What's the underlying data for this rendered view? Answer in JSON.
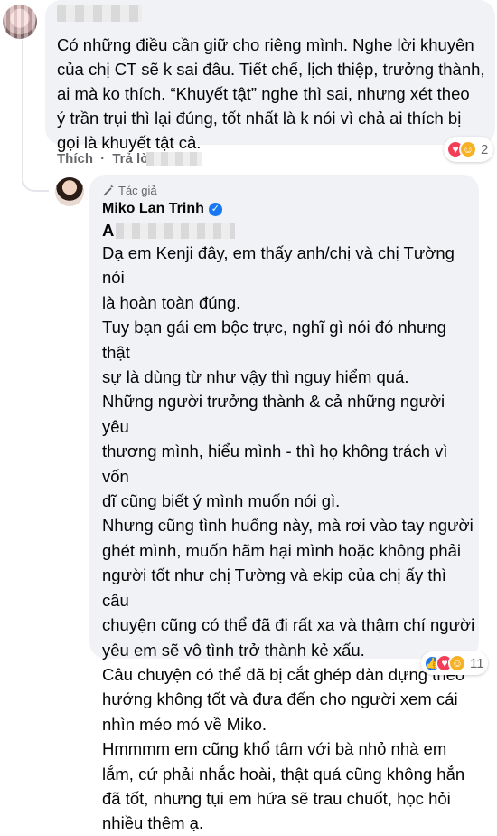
{
  "comment1": {
    "text": "Có những điều cần giữ cho riêng mình. Nghe lời khuyên\ncủa chị CT sẽ k sai đâu. Tiết chế, lịch thiệp, trưởng thành,\nai mà ko thích. “Khuyết tật” nghe thì sai, nhưng xét theo\ný trần trụi thì lại đúng, tốt nhất là k nói vì chả ai thích bị\ngọi là khuyết tật cả.",
    "reaction_count": "2",
    "actions": {
      "like": "Thích",
      "reply": "Trả lời"
    }
  },
  "reply": {
    "badge": "Tác giả",
    "author": "Miko Lan Trinh",
    "addressee_initial": "A",
    "text": "Dạ em Kenji đây, em thấy anh/chị và chị Tường nói\nlà hoàn toàn đúng.\nTuy bạn gái em bộc trực, nghĩ gì nói đó nhưng thật\nsự là dùng từ như vậy thì nguy hiểm quá.\nNhững người trưởng thành & cả những người yêu\nthương mình, hiểu mình - thì họ không trách vì vốn\ndĩ cũng biết ý mình muốn nói gì.\nNhưng cũng tình huống này, mà rơi vào tay người\nghét mình, muốn hãm hại mình hoặc không phải\nngười tốt như chị Tường và ekip của chị ấy thì câu\nchuyện cũng có thể đã đi rất xa và thậm chí người\nyêu em sẽ vô tình trở thành kẻ xấu.\nCâu chuyện có thể đã bị cắt ghép dàn dựng theo\nhướng không tốt và đưa đến cho người xem cái\nnhìn méo mó về Miko.\nHmmmm em cũng khổ tâm với bà nhỏ nhà em\nlắm, cứ phải nhắc hoài, thật quá cũng không hẳn\nđã tốt, nhưng tụi em hứa sẽ trau chuốt, học hỏi\nnhiều thêm ạ.",
    "reaction_count": "11"
  },
  "icons": [
    "heart-reaction-icon",
    "haha-reaction-icon",
    "like-reaction-icon",
    "pencil-icon",
    "verified-icon"
  ],
  "colors": {
    "bubble": "#f0f2f5",
    "secondary_text": "#65676b",
    "verified": "#1877f2",
    "heart": "#f33e58",
    "haha": "#f7b125"
  }
}
